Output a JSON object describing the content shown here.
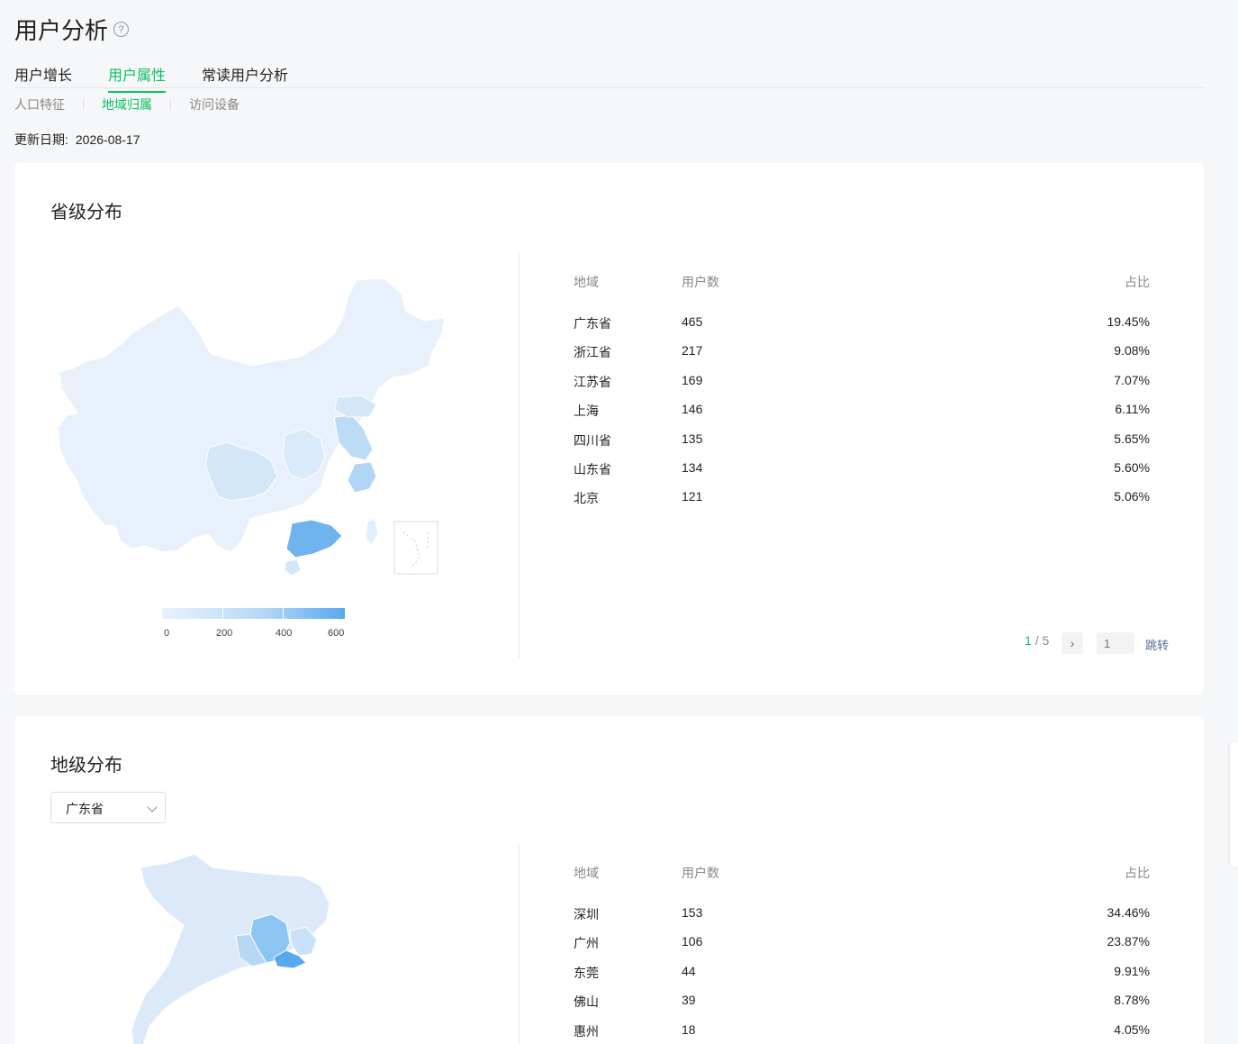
{
  "header": {
    "title": "用户分析",
    "help_icon": "question-circle-icon"
  },
  "tabs": [
    {
      "label": "用户增长",
      "active": false
    },
    {
      "label": "用户属性",
      "active": true
    },
    {
      "label": "常读用户分析",
      "active": false
    }
  ],
  "subtabs": [
    {
      "label": "人口特征",
      "active": false
    },
    {
      "label": "地域归属",
      "active": true
    },
    {
      "label": "访问设备",
      "active": false
    }
  ],
  "update": {
    "label": "更新日期:",
    "date": "2026-08-17"
  },
  "colors": {
    "accent": "#07c160",
    "map_high": "#58a8ee",
    "map_low": "#e8f2fc"
  },
  "province": {
    "title": "省级分布",
    "columns": {
      "region": "地域",
      "users": "用户数",
      "pct": "占比"
    },
    "rows": [
      {
        "region": "广东省",
        "users": "465",
        "pct": "19.45%"
      },
      {
        "region": "浙江省",
        "users": "217",
        "pct": "9.08%"
      },
      {
        "region": "江苏省",
        "users": "169",
        "pct": "7.07%"
      },
      {
        "region": "上海",
        "users": "146",
        "pct": "6.11%"
      },
      {
        "region": "四川省",
        "users": "135",
        "pct": "5.65%"
      },
      {
        "region": "山东省",
        "users": "134",
        "pct": "5.60%"
      },
      {
        "region": "北京",
        "users": "121",
        "pct": "5.06%"
      }
    ],
    "legend": [
      "0",
      "200",
      "400",
      "600"
    ],
    "pager": {
      "current": "1",
      "sep": "/",
      "total": "5",
      "next_icon": "chevron-right-icon",
      "jump_placeholder": "1",
      "jump_label": "跳转"
    }
  },
  "city": {
    "title": "地级分布",
    "select_value": "广东省",
    "columns": {
      "region": "地域",
      "users": "用户数",
      "pct": "占比"
    },
    "rows": [
      {
        "region": "深圳",
        "users": "153",
        "pct": "34.46%"
      },
      {
        "region": "广州",
        "users": "106",
        "pct": "23.87%"
      },
      {
        "region": "东莞",
        "users": "44",
        "pct": "9.91%"
      },
      {
        "region": "佛山",
        "users": "39",
        "pct": "8.78%"
      },
      {
        "region": "惠州",
        "users": "18",
        "pct": "4.05%"
      }
    ]
  }
}
